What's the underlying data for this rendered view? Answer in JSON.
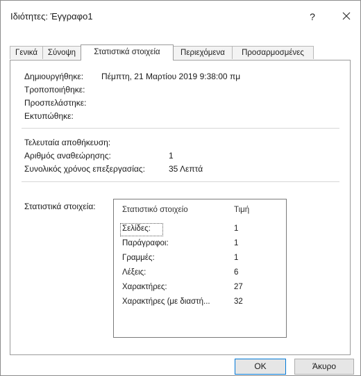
{
  "window": {
    "title": "Ιδιότητες: Έγγραφο1",
    "help_label": "?"
  },
  "tabs": [
    {
      "label": "Γενικά"
    },
    {
      "label": "Σύνοψη"
    },
    {
      "label": "Στατιστικά στοιχεία"
    },
    {
      "label": "Περιεχόμενα"
    },
    {
      "label": "Προσαρμοσμένες"
    }
  ],
  "active_tab": "Στατιστικά στοιχεία",
  "dates": {
    "created_label": "Δημιουργήθηκε:",
    "created_value": "Πέμπτη, 21 Μαρτίου 2019 9:38:00 πμ",
    "modified_label": "Τροποποιήθηκε:",
    "accessed_label": "Προσπελάστηκε:",
    "printed_label": "Εκτυπώθηκε:"
  },
  "editing": {
    "last_saved_label": "Τελευταία αποθήκευση:",
    "revision_label": "Αριθμός αναθεώρησης:",
    "revision_value": "1",
    "total_time_label": "Συνολικός χρόνος επεξεργασίας:",
    "total_time_value": "35 Λεπτά"
  },
  "statistics": {
    "section_label": "Στατιστικά στοιχεία:",
    "col_stat": "Στατιστικό στοιχείο",
    "col_value": "Τιμή",
    "rows": [
      {
        "name": "Σελίδες:",
        "value": "1"
      },
      {
        "name": "Παράγραφοι:",
        "value": "1"
      },
      {
        "name": "Γραμμές:",
        "value": "1"
      },
      {
        "name": "Λέξεις:",
        "value": "6"
      },
      {
        "name": "Χαρακτήρες:",
        "value": "27"
      },
      {
        "name": "Χαρακτήρες (με διαστή...",
        "value": "32"
      }
    ]
  },
  "buttons": {
    "ok": "OK",
    "cancel": "Άκυρο"
  }
}
